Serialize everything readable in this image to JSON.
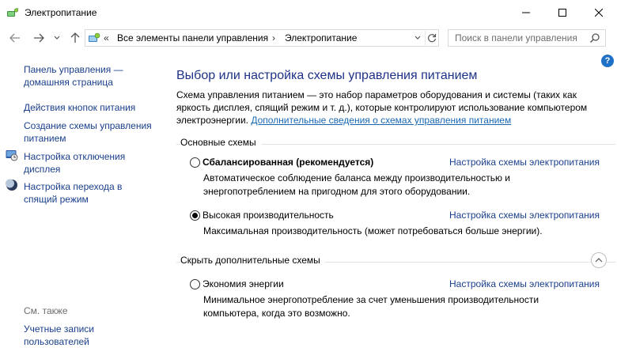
{
  "window": {
    "title": "Электропитание"
  },
  "nav": {
    "address_chevron": "«",
    "breadcrumbs": [
      "Все элементы панели управления",
      "Электропитание"
    ],
    "breadcrumb_separator": "›",
    "search_placeholder": "Поиск в панели управления"
  },
  "help": {
    "label": "?"
  },
  "sidebar": {
    "links": [
      {
        "label": "Панель управления —",
        "label2": "домашняя страница"
      },
      {
        "label": "Действия кнопок питания"
      },
      {
        "label": "Создание схемы управления",
        "label2": "питанием"
      },
      {
        "label": "Настройка отключения",
        "label2": "дисплея",
        "icon": "display-off-icon"
      },
      {
        "label": "Настройка перехода в",
        "label2": "спящий режим",
        "icon": "moon-sleep-icon"
      }
    ],
    "see_also": {
      "title": "См. также",
      "links": [
        {
          "label": "Учетные записи",
          "label2": "пользователей"
        }
      ]
    }
  },
  "main": {
    "title": "Выбор или настройка схемы управления питанием",
    "description": "Схема управления питанием — это набор параметров оборудования и системы (таких как яркость дисплея, спящий режим и т. д.), которые контролируют использование компьютером электроэнергии. ",
    "description_link": "Дополнительные сведения о схемах управления питанием",
    "section_main": "Основные схемы",
    "section_hidden": "Скрыть дополнительные схемы",
    "plan_link_label": "Настройка схемы электропитания",
    "plans": [
      {
        "name": "Сбалансированная (рекомендуется)",
        "selected": false,
        "description": "Автоматическое соблюдение баланса между производительностью и энергопотреблением на пригодном для этого оборудовании."
      },
      {
        "name": "Высокая производительность",
        "selected": true,
        "description": "Максимальная производительность (может потребоваться больше энергии)."
      },
      {
        "name": "Экономия энергии",
        "selected": false,
        "description": "Минимальное энергопотребление за счет уменьшения производительности компьютера, когда это возможно."
      }
    ]
  },
  "colors": {
    "link": "#1a3f8c",
    "title": "#1e3287",
    "help": "#1e71c7"
  }
}
